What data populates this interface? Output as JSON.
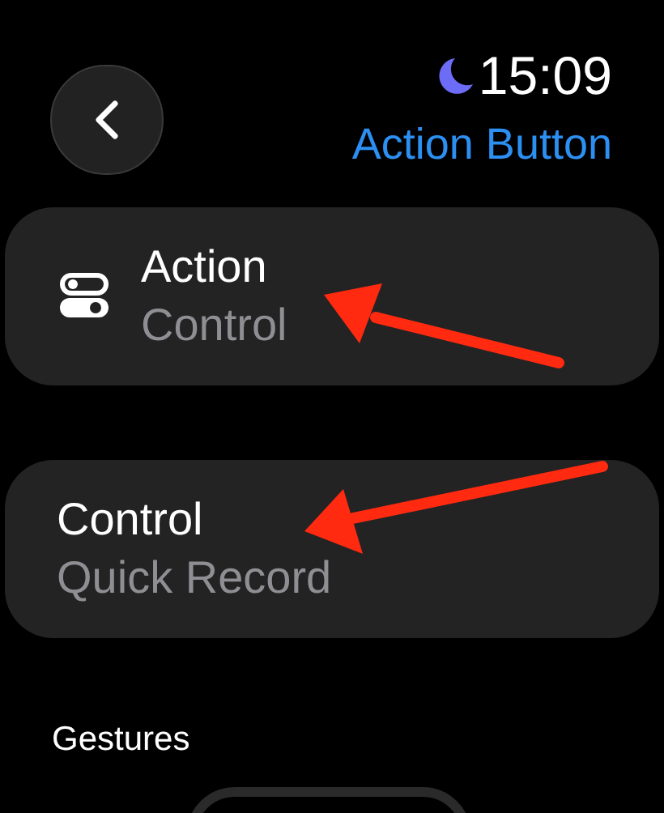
{
  "status": {
    "time": "15:09",
    "do_not_disturb": true
  },
  "header": {
    "title": "Action Button"
  },
  "items": [
    {
      "kind": "with-icon",
      "title": "Action",
      "subtitle": "Control"
    },
    {
      "kind": "plain",
      "title": "Control",
      "subtitle": "Quick Record"
    }
  ],
  "section": {
    "title": "Gestures"
  }
}
